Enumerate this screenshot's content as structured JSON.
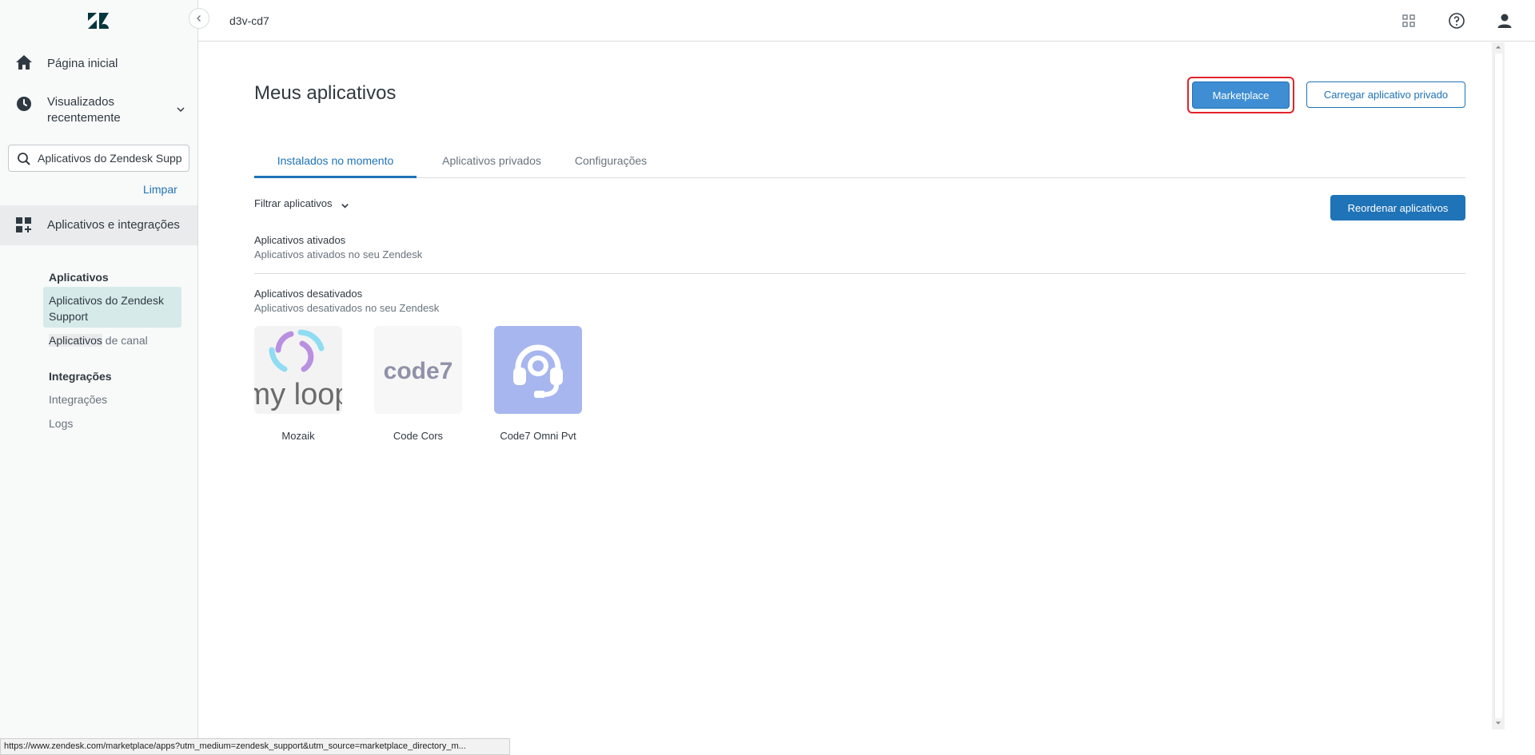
{
  "topbar": {
    "subdomain": "d3v-cd7"
  },
  "sidebar": {
    "home_label": "Página inicial",
    "recent_label": "Visualizados recentemente",
    "search": {
      "value": "Aplicativos do Zendesk Supp",
      "placeholder": ""
    },
    "clear_label": "Limpar",
    "section_label": "Aplicativos e integrações",
    "groups": {
      "apps_heading": "Aplicativos",
      "apps_support": "Aplicativos do Zendesk Support",
      "apps_channel_highlight": "Aplicativos",
      "apps_channel_rest": " de canal",
      "integrations_heading": "Integrações",
      "integrations_item": "Integrações",
      "logs_item": "Logs"
    }
  },
  "main": {
    "title": "Meus aplicativos",
    "marketplace_label": "Marketplace",
    "upload_label": "Carregar aplicativo privado",
    "tabs": [
      {
        "label": "Instalados no momento"
      },
      {
        "label": "Aplicativos privados"
      },
      {
        "label": "Configurações"
      }
    ],
    "filter_label": "Filtrar aplicativos",
    "reorder_label": "Reordenar aplicativos",
    "enabled": {
      "title": "Aplicativos ativados",
      "desc": "Aplicativos ativados no seu Zendesk"
    },
    "disabled": {
      "title": "Aplicativos desativados",
      "desc": "Aplicativos desativados no seu Zendesk",
      "apps": [
        {
          "name": "Mozaik",
          "logo_text": "my loop"
        },
        {
          "name": "Code Cors",
          "logo_text": "code7"
        },
        {
          "name": "Code7 Omni Pvt",
          "icon": "headset-icon"
        }
      ]
    }
  },
  "statusbar": {
    "url": "https://www.zendesk.com/marketplace/apps?utm_medium=zendesk_support&utm_source=marketplace_directory_m..."
  },
  "colors": {
    "accent": "#1f73b7",
    "highlight_border": "#e1242a",
    "headset_tile": "#a7b6ee",
    "active_sub_bg": "#d6eaea"
  }
}
